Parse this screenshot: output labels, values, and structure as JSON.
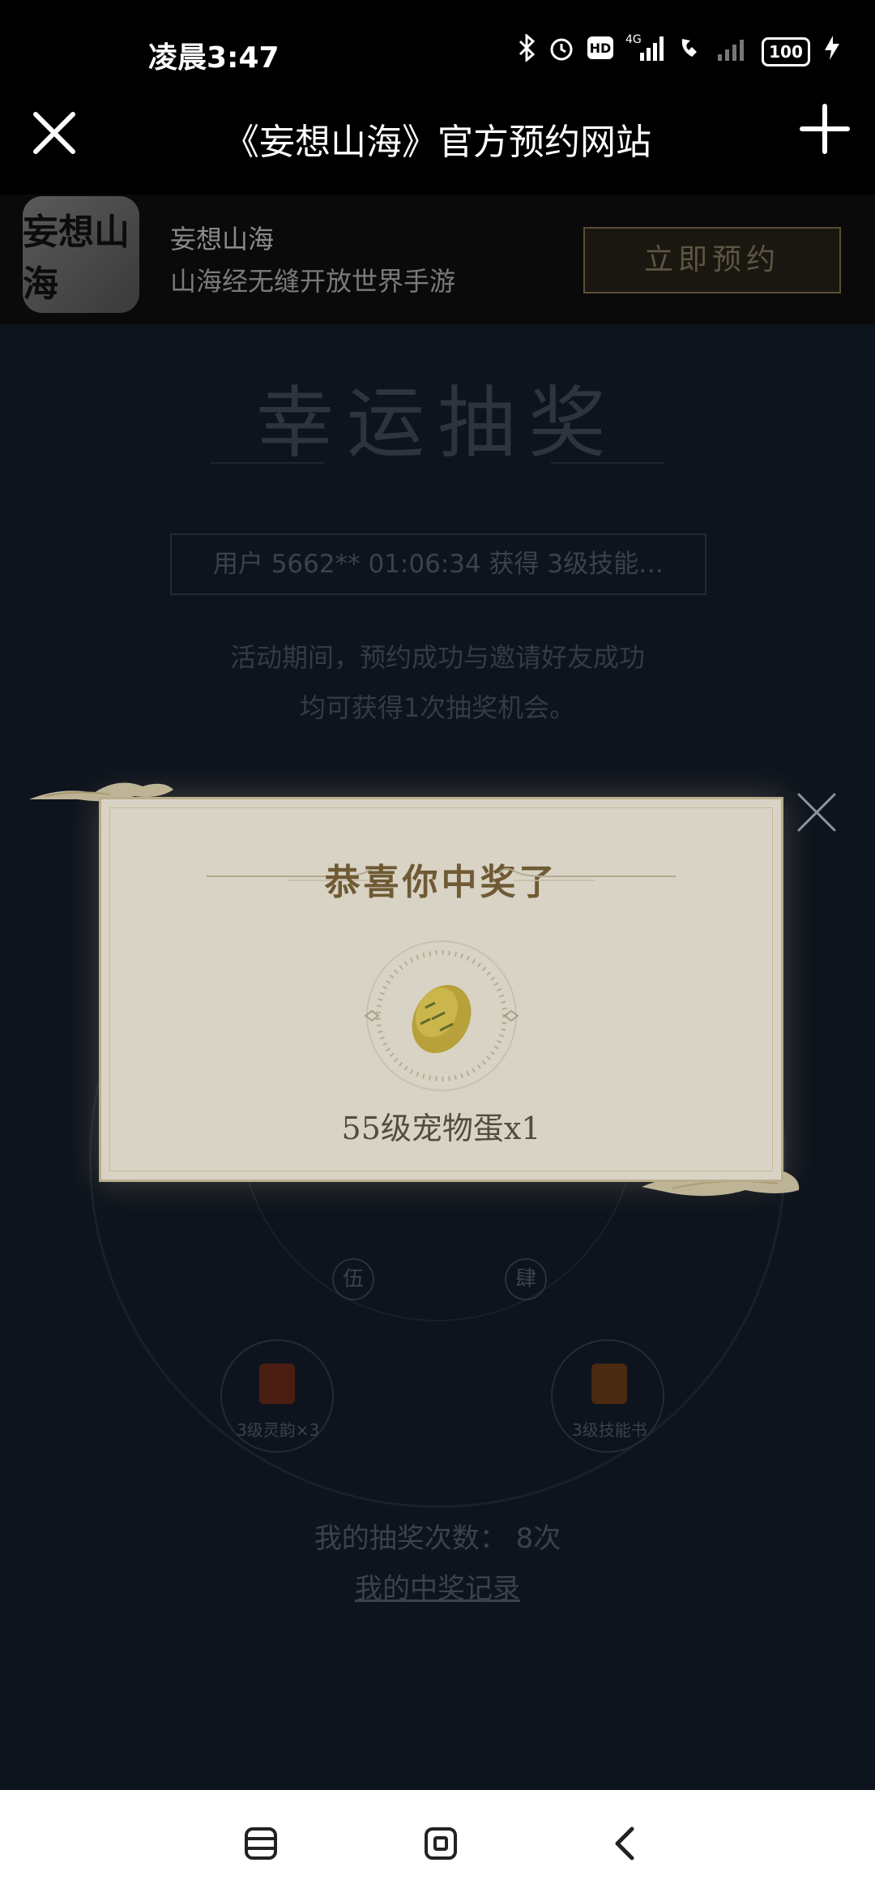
{
  "status_bar": {
    "time": "凌晨3:47",
    "icons": [
      "bluetooth-icon",
      "alarm-icon",
      "hd-icon",
      "signal-4g-icon",
      "call-icon",
      "signal-icon"
    ],
    "battery": "100"
  },
  "title_bar": {
    "title": "《妄想山海》官方预约网站"
  },
  "app_banner": {
    "icon_text": "妄想山海",
    "name": "妄想山海",
    "description": "山海经无缝开放世界手游",
    "reserve_label": "立即预约"
  },
  "lottery": {
    "title": "幸运抽奖",
    "ticker": "用户 5662** 01:06:34 获得 3级技能…",
    "rule_line1": "活动期间，预约成功与邀请好友成功",
    "rule_line2": "均可获得1次抽奖机会。",
    "wheel_labels": [
      "伍",
      "肆"
    ],
    "prizes": [
      {
        "label": "3级灵韵×3"
      },
      {
        "label": "3级技能书"
      }
    ],
    "draw_count": "我的抽奖次数： 8次",
    "record_link": "我的中奖记录"
  },
  "modal": {
    "title": "恭喜你中奖了",
    "prize_name": "55级宠物蛋x1"
  },
  "colors": {
    "overlay_bg": "#0e141d",
    "modal_bg": "#d8d3c5",
    "modal_title": "#6f5a34",
    "egg": "#b8a03a"
  }
}
